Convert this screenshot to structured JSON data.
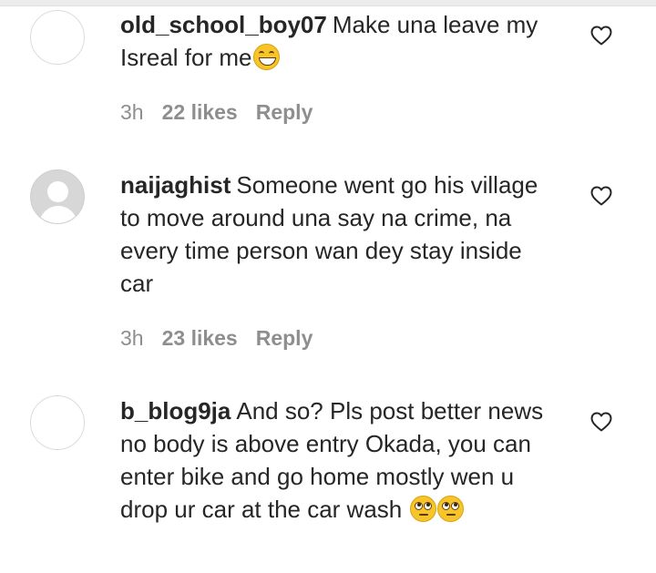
{
  "comments": [
    {
      "username": "old_school_boy07",
      "text": "Make una leave my Isreal for me",
      "emojis": [
        "grinning-squinting-face"
      ],
      "time": "3h",
      "likes": "22 likes",
      "reply": "Reply",
      "avatar": "blank"
    },
    {
      "username": "naijaghist",
      "text": "Someone went go his village to move around una say na crime, na every time person wan dey stay inside car",
      "emojis": [],
      "time": "3h",
      "likes": "23 likes",
      "reply": "Reply",
      "avatar": "default-profile-icon"
    },
    {
      "username": "b_blog9ja",
      "text": "And so? Pls post better news no body is above entry Okada, you can enter bike and go home mostly wen u drop ur car at the car wash",
      "emojis": [
        "face-with-rolling-eyes",
        "face-with-rolling-eyes"
      ],
      "avatar": "blank"
    }
  ],
  "icons": {
    "like": "heart-outline-icon"
  },
  "colors": {
    "text": "#262626",
    "meta": "#8e8e8e"
  }
}
